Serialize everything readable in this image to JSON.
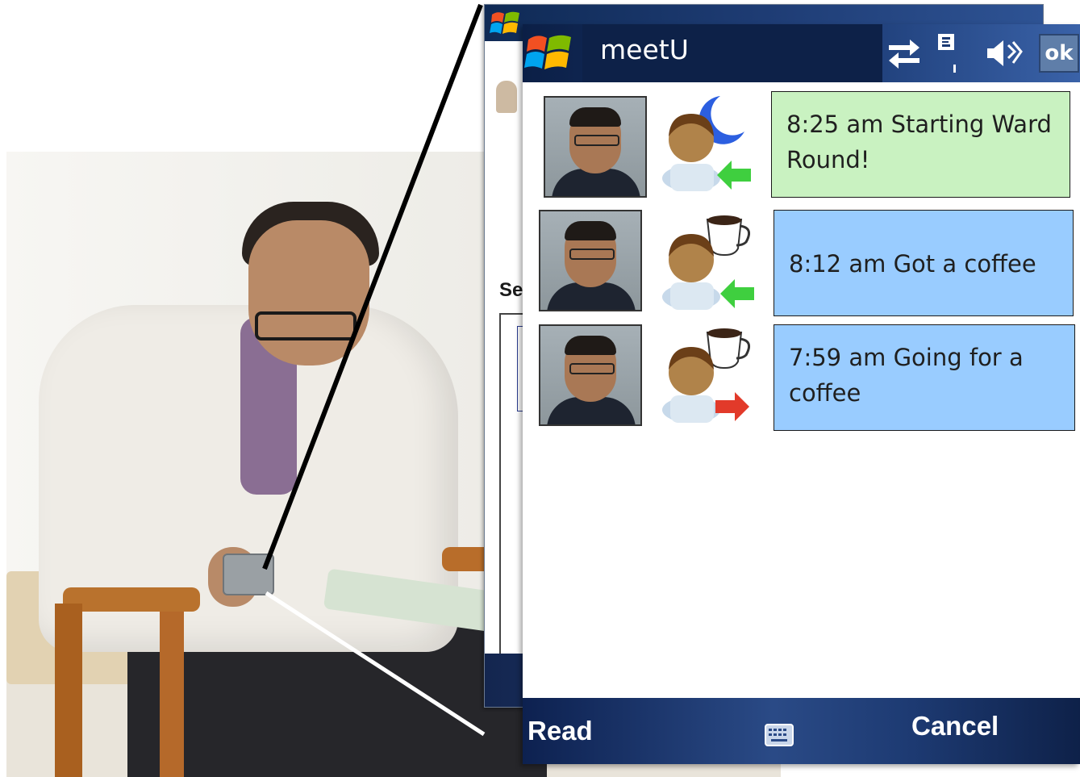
{
  "app": {
    "title": "meetU"
  },
  "status_icons": [
    "connectivity-icon",
    "signal-icon",
    "volume-icon"
  ],
  "ok_label": "ok",
  "background_window": {
    "section_label_partial": "Se"
  },
  "feed": [
    {
      "status": "on-call-night",
      "direction": "in",
      "message": "8:25 am  Starting Ward Round!",
      "color": "#c9f2c1"
    },
    {
      "status": "coffee",
      "direction": "in",
      "message": "8:12 am Got a coffee",
      "color": "#99ccff"
    },
    {
      "status": "coffee",
      "direction": "out",
      "message": "7:59 am Going for a coffee",
      "color": "#99ccff"
    }
  ],
  "softkeys": {
    "left": "Read",
    "right": "Cancel"
  },
  "colors": {
    "titlebar": "#0d2148",
    "message_green": "#c9f2c1",
    "message_blue": "#99ccff",
    "arrow_in": "#3fcf3f",
    "arrow_out": "#e23a2a"
  }
}
